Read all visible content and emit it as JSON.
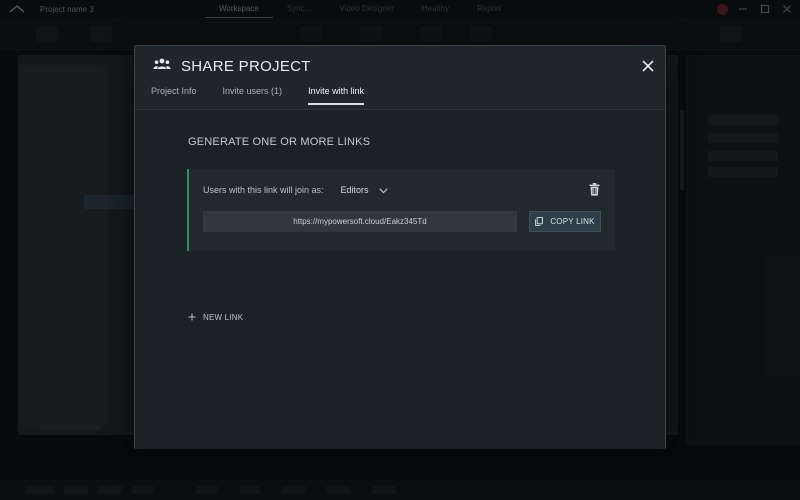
{
  "app": {
    "project_name": "Project name 3",
    "nav_items": [
      "Workspace",
      "Sync...",
      "Video Designer",
      "Healthy",
      "Report"
    ],
    "active_nav": "Workspace"
  },
  "icons": {
    "app_logo": "powersoft-logo-icon",
    "people": "people-group-icon",
    "close": "close-icon",
    "dropdown": "chevron-down-icon",
    "delete": "trash-icon",
    "copy": "copy-icon",
    "add": "plus-icon"
  },
  "colors": {
    "accent_green": "#2f8f5a",
    "modal_bg": "#1b2226",
    "copy_button_bg": "#2e3f4a"
  },
  "modal": {
    "title": "SHARE PROJECT",
    "tabs": [
      {
        "label": "Project Info",
        "active": false
      },
      {
        "label": "Invite users (1)",
        "active": false
      },
      {
        "label": "Invite with link",
        "active": true
      }
    ],
    "section_heading": "GENERATE ONE OR MORE LINKS",
    "link_card": {
      "join_label": "Users with this link will join as:",
      "role": "Editors",
      "url": "https://mypowersoft.cloud/Eakz345Td",
      "copy_label": "COPY LINK"
    },
    "new_link_label": "NEW LINK"
  }
}
